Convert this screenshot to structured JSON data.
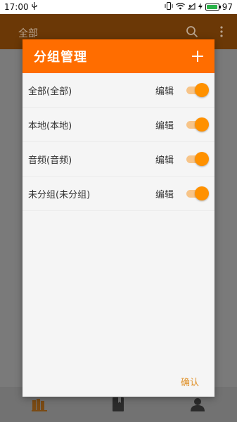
{
  "status_bar": {
    "time": "17:00",
    "battery": "97",
    "battery_level": 0.97,
    "icons": [
      "usb-icon",
      "vibrate-icon",
      "wifi-icon",
      "signal-x-icon",
      "charging-icon"
    ]
  },
  "app_bar": {
    "title": "全部",
    "actions": [
      "search-icon",
      "more-vert-icon"
    ],
    "color": "#6b3806"
  },
  "dialog": {
    "title": "分组管理",
    "add_icon": "plus-icon",
    "header_color": "#ff6d00",
    "groups": [
      {
        "name": "全部(全部)",
        "edit_label": "编辑",
        "enabled": true
      },
      {
        "name": "本地(本地)",
        "edit_label": "编辑",
        "enabled": true
      },
      {
        "name": "音频(音频)",
        "edit_label": "编辑",
        "enabled": true
      },
      {
        "name": "未分组(未分组)",
        "edit_label": "编辑",
        "enabled": true
      }
    ],
    "confirm_label": "确认",
    "toggle_on_color": "#ff9100"
  },
  "bottom_nav": {
    "items": [
      "bookshelf-icon",
      "book-icon",
      "person-icon"
    ]
  }
}
